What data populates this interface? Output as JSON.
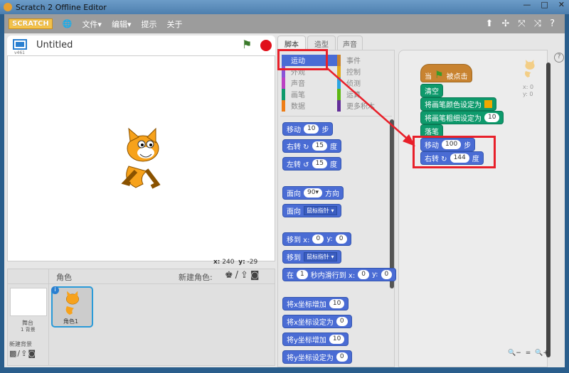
{
  "window": {
    "title": "Scratch 2 Offline Editor",
    "controls": [
      "—",
      "□",
      "✕"
    ]
  },
  "menubar": {
    "logo": "SCRATCH",
    "items": [
      "文件▾",
      "编辑▾",
      "提示",
      "关于"
    ],
    "tools": [
      "⬆",
      "✢",
      "⤧",
      "⤨",
      "?"
    ]
  },
  "stage": {
    "version": "v461",
    "title": "Untitled",
    "mouse_x_label": "x:",
    "mouse_x": "240",
    "mouse_y_label": "y:",
    "mouse_y": "-29"
  },
  "tabs": [
    "脚本",
    "造型",
    "声音"
  ],
  "categories": [
    {
      "label": "运动",
      "color": "#4a6cd4",
      "selected": true
    },
    {
      "label": "事件",
      "color": "#c88330"
    },
    {
      "label": "外观",
      "color": "#8a55d7"
    },
    {
      "label": "控制",
      "color": "#e1a91a"
    },
    {
      "label": "声音",
      "color": "#bb42c3"
    },
    {
      "label": "侦测",
      "color": "#2ca5e2"
    },
    {
      "label": "画笔",
      "color": "#0e9a6c"
    },
    {
      "label": "运算",
      "color": "#5cb712"
    },
    {
      "label": "数据",
      "color": "#ee7d16"
    },
    {
      "label": "更多积木",
      "color": "#632d99"
    }
  ],
  "palette_blocks": [
    [
      {
        "t": "移动"
      },
      {
        "i": "10"
      },
      {
        "t": "步"
      }
    ],
    [
      {
        "t": "右转 ↻"
      },
      {
        "i": "15"
      },
      {
        "t": "度"
      }
    ],
    [
      {
        "t": "左转 ↺"
      },
      {
        "i": "15"
      },
      {
        "t": "度"
      }
    ],
    [
      {
        "t": "面向"
      },
      {
        "i": "90▾"
      },
      {
        "t": "方向"
      }
    ],
    [
      {
        "t": "面向"
      },
      {
        "d": "鼠标指针 ▾"
      }
    ],
    [
      {
        "t": "移到 x:"
      },
      {
        "i": "0"
      },
      {
        "t": "y:"
      },
      {
        "i": "0"
      }
    ],
    [
      {
        "t": "移到"
      },
      {
        "d": "鼠标指针 ▾"
      }
    ],
    [
      {
        "t": "在"
      },
      {
        "i": "1"
      },
      {
        "t": "秒内滑行到 x:"
      },
      {
        "i": "0"
      },
      {
        "t": "y:"
      },
      {
        "i": "0"
      }
    ],
    [
      {
        "t": "将x坐标增加"
      },
      {
        "i": "10"
      }
    ],
    [
      {
        "t": "将x坐标设定为"
      },
      {
        "i": "0"
      }
    ],
    [
      {
        "t": "将y坐标增加"
      },
      {
        "i": "10"
      }
    ],
    [
      {
        "t": "将y坐标设定为"
      },
      {
        "i": "0"
      }
    ]
  ],
  "script_blocks": [
    {
      "kind": "hat",
      "parts": [
        {
          "t": "当"
        },
        {
          "t": "⚑"
        },
        {
          "t": "被点击"
        }
      ]
    },
    {
      "kind": "pen",
      "parts": [
        {
          "t": "清空"
        }
      ]
    },
    {
      "kind": "pen",
      "parts": [
        {
          "t": "将画笔颜色设定为"
        },
        {
          "c": "#f0a800"
        }
      ]
    },
    {
      "kind": "pen",
      "parts": [
        {
          "t": "将画笔粗细设定为"
        },
        {
          "i": "10"
        }
      ]
    },
    {
      "kind": "pen",
      "parts": [
        {
          "t": "落笔"
        }
      ]
    },
    {
      "kind": "motion",
      "parts": [
        {
          "t": "移动"
        },
        {
          "i": "100"
        },
        {
          "t": "步"
        }
      ]
    },
    {
      "kind": "motion",
      "parts": [
        {
          "t": "右转 ↻"
        },
        {
          "i": "144"
        },
        {
          "t": "度"
        }
      ]
    }
  ],
  "sprite_info": {
    "x": "x: 0",
    "y": "y: 0"
  },
  "sprites": {
    "header": "角色",
    "new_sprite_label": "新建角色:",
    "stage_label": "舞台",
    "backdrop_count": "1 背景",
    "new_backdrop_label": "新建背景",
    "sprite_name": "角色1"
  },
  "zoom_controls": [
    "🔍−",
    "=",
    "🔍+"
  ]
}
